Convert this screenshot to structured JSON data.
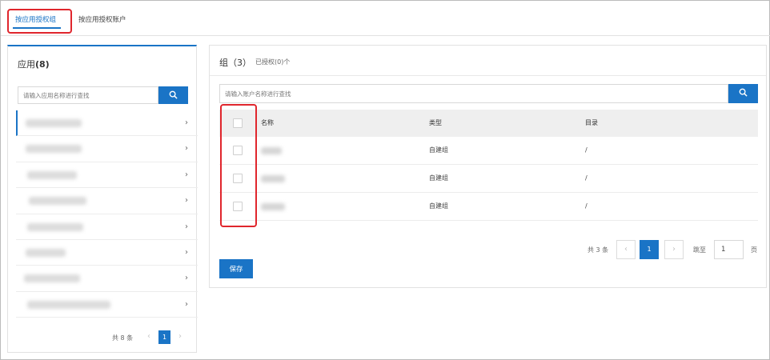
{
  "tabs": [
    {
      "label": "按应用授权组",
      "active": true
    },
    {
      "label": "按应用授权账户",
      "active": false
    }
  ],
  "left_panel": {
    "title": "应用",
    "count": "(8)",
    "search_placeholder": "请输入应用名称进行查找",
    "items_count": 8,
    "pager": {
      "total": "共 8 条",
      "current_page": "1",
      "prev": "‹",
      "next": "›"
    }
  },
  "right_panel": {
    "title": "组（3）",
    "subtitle": "已授权(0)个",
    "search_placeholder": "请输入账户名称进行查找",
    "columns": {
      "name": "名称",
      "type": "类型",
      "directory": "目录"
    },
    "rows": [
      {
        "type": "自建组",
        "directory": "/"
      },
      {
        "type": "自建组",
        "directory": "/"
      },
      {
        "type": "自建组",
        "directory": "/"
      }
    ],
    "pager": {
      "total": "共 3 条",
      "prev": "‹",
      "current_page": "1",
      "next": "›",
      "goto_label": "跳至",
      "goto_value": "1",
      "page_unit": "页"
    },
    "save_label": "保存"
  },
  "colors": {
    "accent": "#1a74c6",
    "highlight": "#e0262d"
  },
  "icons": {
    "search": "search-icon",
    "chevron": "chevron-right-icon"
  }
}
